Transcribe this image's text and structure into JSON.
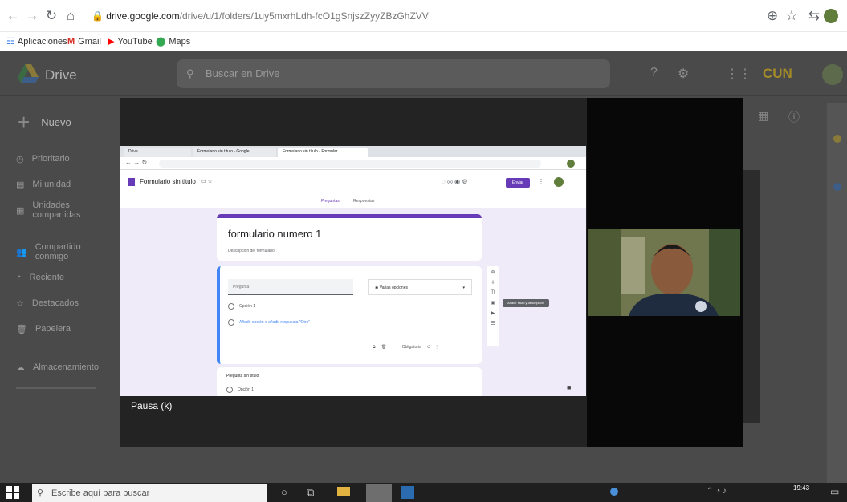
{
  "browser": {
    "url_host": "drive.google.com",
    "url_path": "/drive/u/1/folders/1uy5mxrhLdh-fcO1gSnjszZyyZBzGhZVV",
    "bookmarks": [
      "Aplicaciones",
      "Gmail",
      "YouTube",
      "Maps"
    ]
  },
  "drive": {
    "app_name": "Drive",
    "search_placeholder": "Buscar en Drive",
    "new_label": "Nuevo",
    "sidebar": [
      "Prioritario",
      "Mi unidad",
      "Unidades compartidas",
      "Compartido conmigo",
      "Reciente",
      "Destacados",
      "Papelera",
      "Almacenamiento"
    ],
    "org_logo_text": "CUN"
  },
  "video": {
    "pause_label": "Pausa (k)"
  },
  "shared_screen": {
    "tabs": [
      "Drive",
      "Formulario sin título - Google",
      "Formulario sin título - Formular"
    ],
    "form_name": "Formulario sin titulo",
    "send_label": "Enviar",
    "form_tabs": [
      "Preguntas",
      "Respuestas"
    ],
    "form_title": "formulario numero 1",
    "form_description": "Descripción del formulario",
    "question_placeholder": "Pregunta",
    "question_type": "Varias opciones",
    "option_1": "Opción 1",
    "add_option": "Añadir opción o añadir respuesta \"Otro\"",
    "required_label": "Obligatoria",
    "tooltip": "Añadir título y descripción",
    "question2_title": "Pregunta sin título",
    "question2_option": "Opción 1"
  },
  "taskbar": {
    "search_placeholder": "Escribe aquí para buscar",
    "time": "19:43"
  },
  "colors": {
    "form_accent": "#673ab7",
    "question_highlight": "#4285f4"
  }
}
